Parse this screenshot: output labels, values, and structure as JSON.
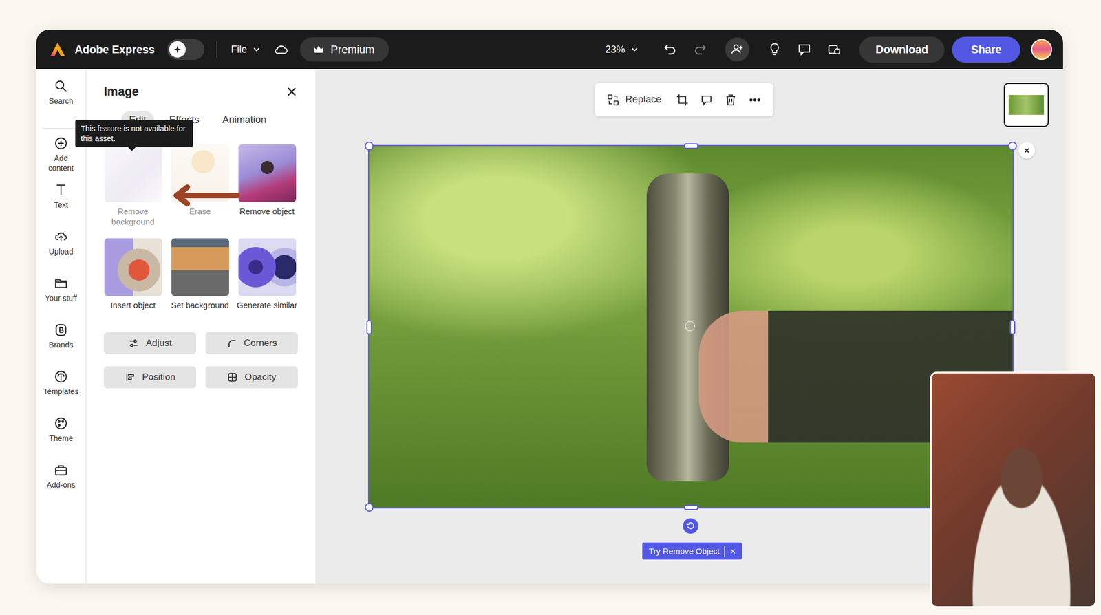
{
  "app_name": "Adobe Express",
  "top_bar": {
    "file": "File",
    "premium": "Premium",
    "zoom": "23%",
    "download": "Download",
    "share": "Share",
    "redo_disabled": true
  },
  "rail": [
    {
      "label": "Search",
      "kind": "search"
    },
    {
      "label": "Add content",
      "kind": "add"
    },
    {
      "label": "Text",
      "kind": "text"
    },
    {
      "label": "Upload",
      "kind": "upload"
    },
    {
      "label": "Your stuff",
      "kind": "folder"
    },
    {
      "label": "Brands",
      "kind": "brands"
    },
    {
      "label": "Templates",
      "kind": "templates"
    },
    {
      "label": "Theme",
      "kind": "theme"
    },
    {
      "label": "Add-ons",
      "kind": "addons"
    }
  ],
  "panel": {
    "title": "Image",
    "tabs": [
      {
        "label": "Edit",
        "selected": true
      },
      {
        "label": "Effects",
        "selected": false
      },
      {
        "label": "Animation",
        "selected": false
      }
    ],
    "tooltip": "This feature is not available for this asset.",
    "tools": [
      {
        "label": "Remove background",
        "disabled": true,
        "kind": "remove-bg"
      },
      {
        "label": "Erase",
        "disabled": true,
        "kind": "erase"
      },
      {
        "label": "Remove object",
        "disabled": false,
        "kind": "remove-object"
      },
      {
        "label": "Insert object",
        "disabled": false,
        "kind": "insert-object"
      },
      {
        "label": "Set background",
        "disabled": false,
        "kind": "set-background"
      },
      {
        "label": "Generate similar",
        "disabled": false,
        "kind": "generate-similar"
      }
    ],
    "buttons": [
      {
        "label": "Adjust",
        "kind": "adjust"
      },
      {
        "label": "Corners",
        "kind": "corners"
      },
      {
        "label": "Position",
        "kind": "position"
      },
      {
        "label": "Opacity",
        "kind": "opacity"
      }
    ]
  },
  "toolbar": {
    "replace": "Replace"
  },
  "canvas": {
    "hint": "Try Remove Object",
    "selected": true
  }
}
